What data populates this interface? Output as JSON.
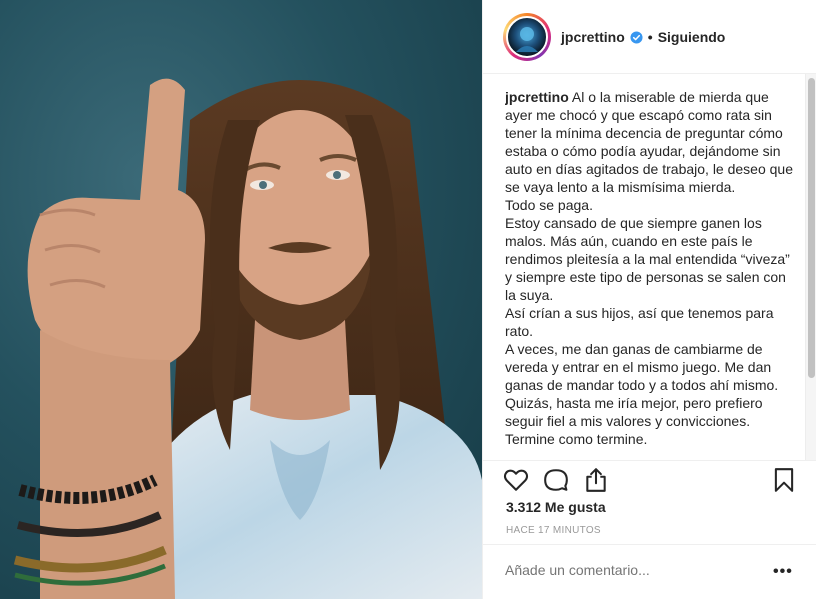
{
  "post": {
    "username": "jpcrettino",
    "follow_dot": "•",
    "follow_status": "Siguiendo",
    "caption_user": "jpcrettino",
    "caption_paragraphs": [
      "Al o la miserable de mierda que ayer me chocó y que escapó como rata sin tener la mínima decencia de preguntar cómo estaba o cómo podía ayudar, dejándome sin auto en días agitados de trabajo, le deseo que se vaya lento a la mismísima mierda.",
      "Todo se paga.",
      "Estoy cansado de que siempre ganen los malos. Más aún, cuando en este país le rendimos pleitesía a la mal entendida “viveza” y siempre este tipo de personas se salen con la suya.",
      "Así crían a sus hijos, así que tenemos para rato.",
      "A veces, me dan ganas de cambiarme de vereda y entrar en el mismo juego. Me dan ganas de mandar todo y a todos ahí mismo. Quizás, hasta me iría mejor, pero prefiero seguir fiel a mis valores y convicciones. Termine como termine."
    ],
    "likes": "3.312 Me gusta",
    "timestamp": "HACE 17 MINUTOS",
    "comment_placeholder": "Añade un comentario...",
    "more_label": "•••"
  },
  "icons": {
    "verified": "verified-badge-icon",
    "like": "heart-icon",
    "comment": "comment-icon",
    "share": "share-icon",
    "save": "bookmark-icon"
  },
  "colors": {
    "verified_blue": "#3897f0",
    "text": "#262626",
    "muted": "#999999",
    "border": "#efefef",
    "photo_background": "#24515e"
  }
}
